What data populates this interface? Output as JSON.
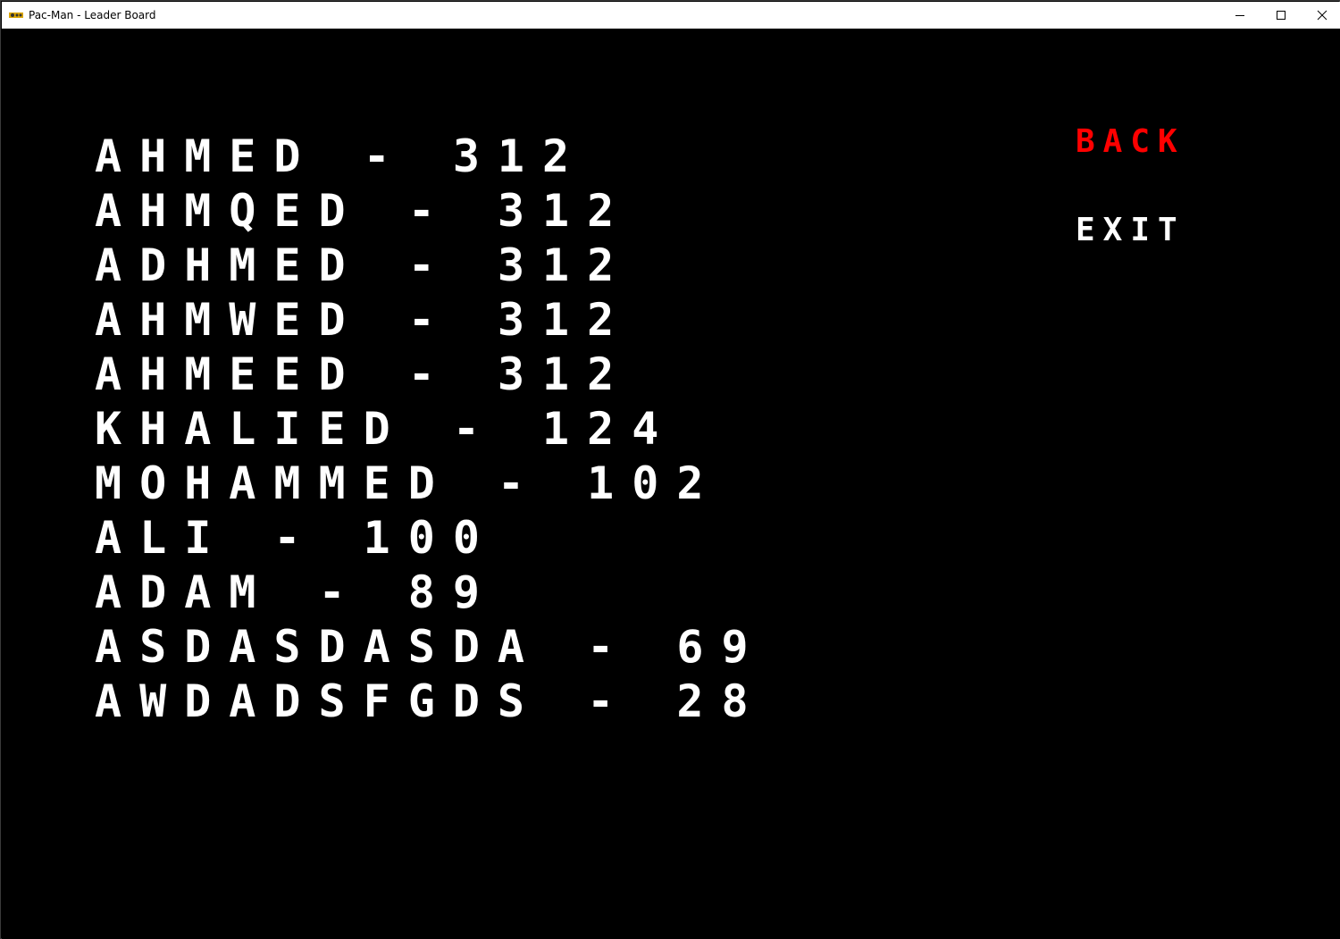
{
  "window": {
    "title": "Pac-Man - Leader Board"
  },
  "leaderboard": [
    {
      "name": "AHMED",
      "score": "312"
    },
    {
      "name": "AHMQED",
      "score": "312"
    },
    {
      "name": "ADHMED",
      "score": "312"
    },
    {
      "name": "AHMWED",
      "score": "312"
    },
    {
      "name": "AHMEED",
      "score": "312"
    },
    {
      "name": "KHALIED",
      "score": "124"
    },
    {
      "name": "MOHAMMED",
      "score": "102"
    },
    {
      "name": "ALI",
      "score": "100"
    },
    {
      "name": "ADAM",
      "score": "89"
    },
    {
      "name": "ASDASDASDA",
      "score": "69"
    },
    {
      "name": "AWDADSFGDS",
      "score": "28"
    }
  ],
  "menu": {
    "back_label": "BACK",
    "exit_label": "EXIT"
  },
  "colors": {
    "background": "#000000",
    "text": "#ffffff",
    "selected": "#ff0000"
  },
  "icons": {
    "app": "pacman-app-icon",
    "minimize": "minimize-icon",
    "maximize": "maximize-icon",
    "close": "close-icon"
  }
}
